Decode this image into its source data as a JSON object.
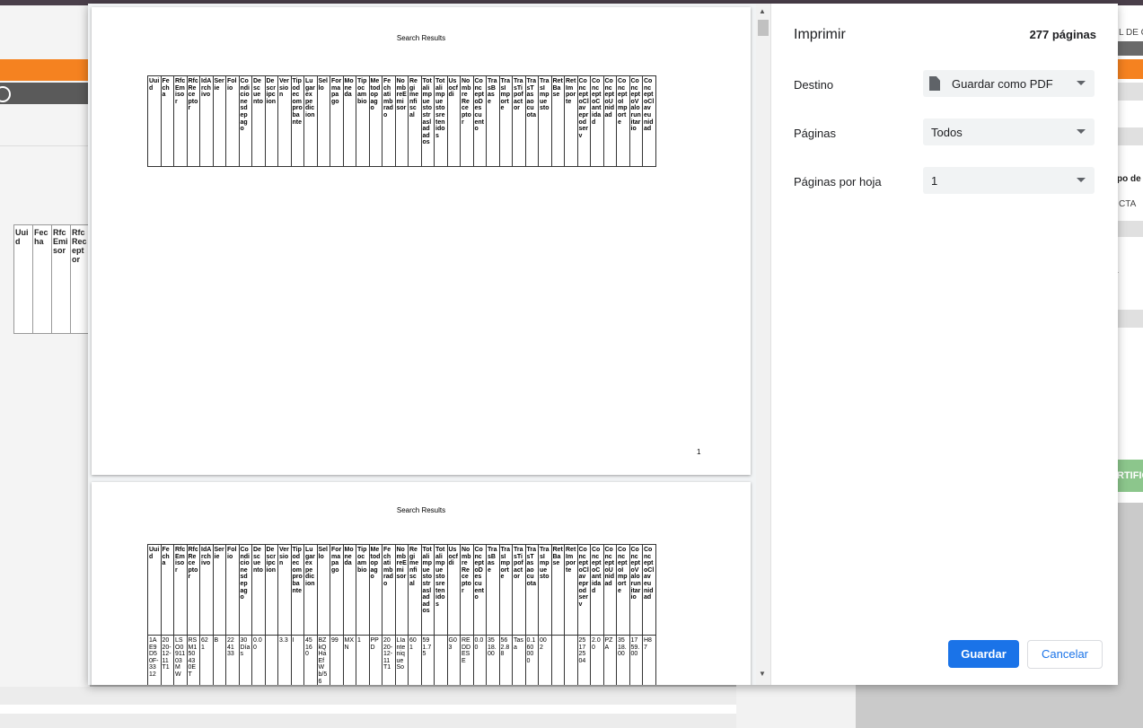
{
  "background": {
    "table_headers": [
      "Uuid",
      "Fecha",
      "RfcEmisor",
      "RfcReceptor"
    ],
    "right_fragments": {
      "top": "L DE C",
      "tipo": "po de",
      "cta": "CTA",
      "a": "a",
      "cert": "RTIFIC"
    }
  },
  "preview": {
    "page1": {
      "title": "Search Results",
      "page_number": "1"
    },
    "page2": {
      "title": "Search Results"
    },
    "columns": [
      "Uuid",
      "Fecha",
      "RfcEmisor",
      "RfcReceptor",
      "IdArchivo",
      "Serie",
      "Folio",
      "Condicionesdepago",
      "Descuento",
      "Descripcion",
      "Version",
      "Tipodecomprobante",
      "Lugarexpedicion",
      "Sello",
      "Formapago",
      "Moneda",
      "Tipocambio",
      "Metodopago",
      "Fechatimbrado",
      "NombreEmisor",
      "Regimenfiscal",
      "Totalimpuestostrasladados",
      "Totalimpuestosretenidos",
      "Usocfdi",
      "NombreReceptor",
      "ConceptoDescuento",
      "TrasBase",
      "TrasImporte",
      "TrasTipofactor",
      "TrasTasaocuota",
      "TrasImpuesto",
      "RetBase",
      "RetImporte",
      "ConceptoClaveprodserv",
      "ConceptoCantidad",
      "ConceptoUnidad",
      "ConceptoImporte",
      "ConceptoValorunitario",
      "ConceptoClaveunidad"
    ],
    "row1": [
      "1AE9D50F-3312",
      "2020-12-11T1",
      "LSO091103MW",
      "RSM150430ET",
      "621",
      "B",
      "224133",
      "30 Días",
      "0.00",
      "",
      "3.3",
      "I",
      "45160",
      "BZkQHaEfWb/56",
      "99",
      "MXN",
      "1",
      "PPD",
      "2020-12-11T1",
      "LIanteniqueSo",
      "601",
      "591.75",
      "",
      "G03",
      "REDDESE",
      "0.00",
      "3518.00",
      "562.88",
      "Tasa",
      "0.160000",
      "002",
      "",
      "",
      "25172504",
      "2.00",
      "PZA",
      "3518.00",
      "1759.00",
      "H87"
    ]
  },
  "settings": {
    "title": "Imprimir",
    "page_count": "277 páginas",
    "destination_label": "Destino",
    "destination_value": "Guardar como PDF",
    "pages_label": "Páginas",
    "pages_value": "Todos",
    "per_sheet_label": "Páginas por hoja",
    "per_sheet_value": "1",
    "save_button": "Guardar",
    "cancel_button": "Cancelar"
  },
  "colors": {
    "accent": "#1a73e8",
    "orange": "#f58220"
  }
}
